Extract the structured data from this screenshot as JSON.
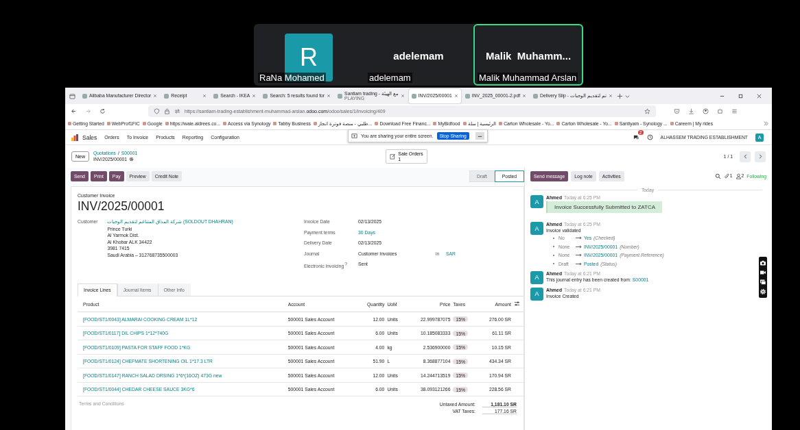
{
  "call": {
    "participants": [
      {
        "name": "RaNa Mohamed",
        "tile_text": "R",
        "kind": "avatar",
        "speaking": false
      },
      {
        "name": "adelemam",
        "tile_text": "adelemam",
        "kind": "text",
        "speaking": false
      },
      {
        "name": "Malik Muhammad Arslan",
        "tile_text": "Malik  Muhamm...",
        "kind": "text",
        "speaking": true
      }
    ]
  },
  "browser": {
    "tabs": [
      {
        "label": "Alibaba Manufacturer Director",
        "selected": false
      },
      {
        "label": "Receipt",
        "selected": false
      },
      {
        "label": "Search - IKEA",
        "selected": false
      },
      {
        "label": "Search: 5 results found for",
        "selected": false
      },
      {
        "label": "Santiam trading - مع الهيئة",
        "sublabel": "PLAYING",
        "selected": false
      },
      {
        "label": "INV/2025/00001",
        "selected": true
      },
      {
        "label": "INV_2025_00001-2.pdf",
        "selected": false
      },
      {
        "label": "Delivery Slip - تم لتقديم الوجبات",
        "selected": false
      }
    ],
    "url": {
      "prefix": "https://santiam-trading-establishment-muhammad-arslan.",
      "domain": "odoo.com",
      "path": "/odoo/sales/1/invoicing/409"
    },
    "bookmarks": [
      "Getting Started",
      "WebProf1FIC",
      "Google",
      "https://waie.aldrees.co...",
      "Access via Synology",
      "Tabby Business",
      "طلبي - منصة فوترة انجاز...",
      "Download Free Financ...",
      "MyBidfood",
      "الرئيسية | سلة",
      "Carton Wholesale - Yo...",
      "Carton Wholesale - Yo...",
      "Santiyam - Synology ...",
      "Careem | My rides"
    ]
  },
  "sharing_bar": {
    "message": "You are sharing your entire screen.",
    "button": "Stop Sharing"
  },
  "app": {
    "name": "Sales",
    "menu": [
      "Orders",
      "To Invoice",
      "Products",
      "Reporting",
      "Configuration"
    ],
    "message_count": "2",
    "company": "ALHASSEM TRADING ESTABLISHMENT",
    "user_initial": "A"
  },
  "control": {
    "new_button": "New",
    "separator": "/",
    "parents": [
      "Quotations",
      "S00001"
    ],
    "current": "INV/2025/00001",
    "smart_button": {
      "label": "Sale Orders",
      "count": "1"
    },
    "pager": "1 / 1"
  },
  "actions": [
    {
      "label": "Send",
      "kind": "primary"
    },
    {
      "label": "Print",
      "kind": "primary"
    },
    {
      "label": "Pay",
      "kind": "primary"
    },
    {
      "label": "Preview",
      "kind": "secondary"
    },
    {
      "label": "Credit Note",
      "kind": "secondary"
    }
  ],
  "status": [
    {
      "label": "Draft",
      "selected": false
    },
    {
      "label": "Posted",
      "selected": true
    }
  ],
  "chatter_buttons": [
    {
      "label": "Send message",
      "kind": "primary"
    },
    {
      "label": "Log note",
      "kind": "secondary"
    },
    {
      "label": "Activities",
      "kind": "secondary"
    }
  ],
  "followers": {
    "attachments": "1",
    "followers": "2",
    "label": "Following"
  },
  "invoice": {
    "type": "Customer Invoice",
    "number": "INV/2025/00001",
    "customer_label": "Customer",
    "customer": "شركة المذاق المتناغم لتقديم الوجبات (SOLDOUT DHAHRAN)",
    "address": [
      "Prince Turki",
      "Al Yarmok Dist.",
      "Al Khobar ALK 34422",
      "3981 7415",
      "Saudi Arabia – 312768735500003"
    ],
    "fields": [
      {
        "label": "Invoice Date",
        "value": "02/13/2025",
        "kind": "text"
      },
      {
        "label": "Payment terms",
        "value": "30 Days",
        "kind": "link"
      },
      {
        "label": "Delivery Date",
        "value": "02/13/2025",
        "kind": "text"
      },
      {
        "label": "Journal",
        "value": "Customer Invoices",
        "kind": "currency",
        "joiner": "in",
        "currency": "SAR"
      },
      {
        "label": "Electronic invoicing",
        "help": "?",
        "value": "Sent",
        "kind": "text"
      }
    ]
  },
  "form_tabs": [
    {
      "label": "Invoice Lines",
      "selected": true
    },
    {
      "label": "Journal Items",
      "selected": false
    },
    {
      "label": "Other Info",
      "selected": false
    }
  ],
  "table": {
    "columns": [
      "Product",
      "Account",
      "Quantity",
      "UoM",
      "Price",
      "Taxes",
      "Amount"
    ],
    "rows": [
      [
        "[FOOD/ST1/0043] ALMARAI COOKING CREAM 1L*12",
        "500001 Sales Account",
        "12.00",
        "Units",
        "22.999787075",
        "15%",
        "276.00 SR"
      ],
      [
        "[FOOD/ST1/0117] DIL CHIPS 1*12*740G",
        "500001 Sales Account",
        "6.00",
        "Units",
        "10.185083333",
        "15%",
        "61.11 SR"
      ],
      [
        "[FOOD/ST1/0109] PASTA FOR STAFF FOOD 1*KG",
        "500001 Sales Account",
        "4.00",
        "kg",
        "2.536900000",
        "15%",
        "10.15 SR"
      ],
      [
        "[FOOD/ST1/0124] CHEFMATE SHORTENING OIL 1*17.3 LTR",
        "500001 Sales Account",
        "51.90",
        "L",
        "8.368877104",
        "15%",
        "434.34 SR"
      ],
      [
        "[FOOD/ST1/0147] RANCH SALAD DRSING 1*6*(16OZ) 473G new",
        "500001 Sales Account",
        "12.00",
        "Units",
        "14.244713519",
        "15%",
        "170.94 SR"
      ],
      [
        "[FOOD/ST1/0044] CHEDAR CHEESE SAUCE 3KG*6",
        "500001 Sales Account",
        "6.00",
        "Units",
        "38.093121266",
        "15%",
        "228.56 SR"
      ]
    ]
  },
  "terms_placeholder": "Terms and Conditions",
  "totals": [
    {
      "label": "Untaxed Amount:",
      "value": "1,181.10 SR",
      "bold": true
    },
    {
      "label": "VAT Taxes:",
      "value": "177.16 SR",
      "bold": false
    }
  ],
  "chatter": {
    "separator": "Today",
    "messages": [
      {
        "author": "Ahmed",
        "initial": "A",
        "time": "Today at 6:25 PM",
        "kind": "highlight",
        "body": "Invoice Successfully Submitted to ZATCA"
      },
      {
        "author": "Ahmed",
        "initial": "A",
        "time": "Today at 6:25 PM",
        "kind": "changes",
        "body": "Invoice validated",
        "changes": [
          {
            "old": "No",
            "new": "Yes",
            "field": "(Checked)"
          },
          {
            "old": "None",
            "new": "INV/2025/00001",
            "field": "(Number)"
          },
          {
            "old": "None",
            "new": "INV/2025/00001",
            "field": "(Payment Reference)"
          },
          {
            "old": "Draft",
            "new": "Posted",
            "field": "(Status)"
          }
        ]
      },
      {
        "author": "Ahmed",
        "initial": "A",
        "time": "Today at 6:21 PM",
        "kind": "link",
        "body": "This journal entry has been created from:",
        "link": "S00001"
      },
      {
        "author": "Ahmed",
        "initial": "A",
        "time": "Today at 6:21 PM",
        "kind": "text",
        "body": "Invoice Created"
      }
    ]
  }
}
